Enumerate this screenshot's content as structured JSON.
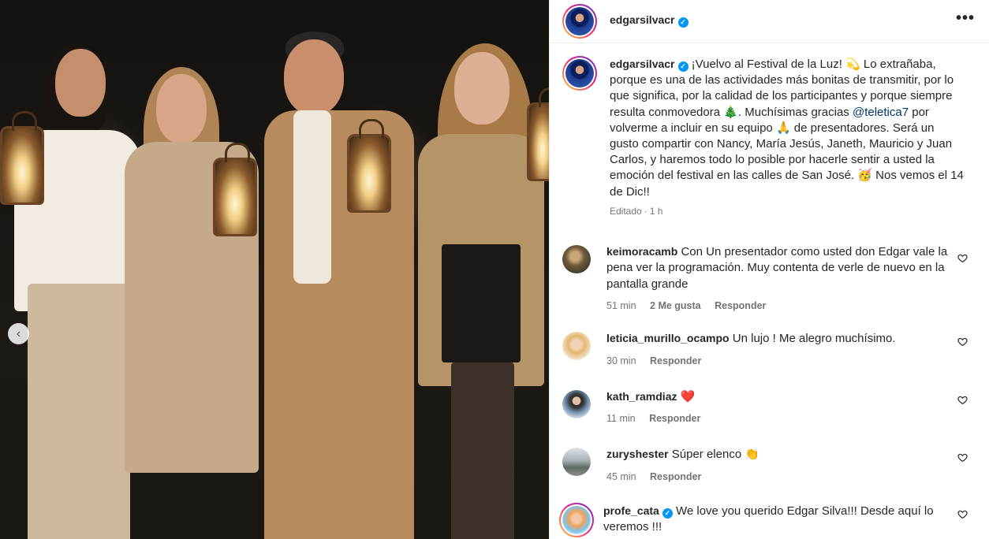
{
  "post": {
    "author": "edgarsilvacr",
    "caption_parts": [
      "¡Vuelvo al Festival de la Luz! 💫 Lo extrañaba, porque es una de las actividades más bonitas de transmitir, por lo que significa, por la calidad de los participantes y porque siempre resulta conmovedora 🎄. Muchísimas gracias ",
      "@teletica7",
      " por volverme a incluir en su equipo 🙏 de presentadores. Será un gusto compartir con Nancy, María Jesús, Janeth, Mauricio y Juan Carlos, y haremos todo lo posible por hacerle sentir a usted la emoción del festival en las calles de San José. 🥳 Nos vemos el 14 de Dic!!"
    ],
    "edited_label": "Editado",
    "time": "1 h"
  },
  "comments": [
    {
      "user": "keimoracamb",
      "text": "Con Un presentador como usted don Edgar vale la pena ver la programación. Muy contenta de verle de nuevo en la pantalla grande",
      "time": "51 min",
      "likes": "2 Me gusta",
      "reply": "Responder"
    },
    {
      "user": "leticia_murillo_ocampo",
      "text": "Un lujo ! Me alegro muchísimo.",
      "time": "30 min",
      "reply": "Responder"
    },
    {
      "user": "kath_ramdiaz",
      "text": "❤️",
      "time": "11 min",
      "reply": "Responder"
    },
    {
      "user": "zuryshester",
      "text": "Súper elenco 👏",
      "time": "45 min",
      "reply": "Responder"
    },
    {
      "user": "profe_cata",
      "text": "We love you querido Edgar Silva!!! Desde aquí lo veremos !!!"
    }
  ],
  "icons": {
    "verified": "verified-badge-icon",
    "more": "more-options-icon",
    "like": "heart-icon",
    "prev": "chevron-left-icon"
  },
  "colors": {
    "accent": "#0095f6",
    "mention": "#00376b",
    "muted": "#737373",
    "text": "#262626"
  }
}
